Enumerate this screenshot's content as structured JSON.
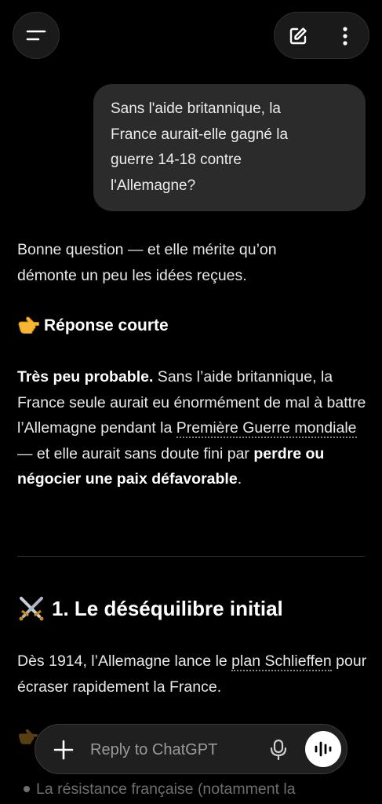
{
  "user_message": {
    "line1": "Sans l'aide britannique, la",
    "line2": "France aurait-elle gagné la",
    "line3": "guerre 14-18 contre",
    "line4": "l'Allemagne?"
  },
  "response": {
    "intro_line1": "Bonne question — et elle mérite qu’on",
    "intro_line2": "démonte un peu les idées reçues.",
    "short_heading": "Réponse courte",
    "short_p1_bold": "Très peu probable.",
    "short_p1_text": " Sans l’aide britannique, la France seule aurait eu énormément de mal à battre l’Allemagne pendant la ",
    "short_p1_link": "Première Guerre mondiale",
    "short_p1_text2": " — et elle aurait sans doute fini par ",
    "short_p1_bold2": "perdre ou négocier une paix défavorable",
    "short_p1_end": ".",
    "section1_heading": "1. Le déséquilibre initial",
    "section1_text": "Dès 1914, l’Allemagne lance le ",
    "section1_link": "plan Schlieffen",
    "section1_text2": " pour écraser rapidement la France.",
    "faded_bullet": "La résistance française (notamment la"
  },
  "composer": {
    "placeholder": "Reply to ChatGPT"
  },
  "icons": {
    "menu": "menu-icon",
    "edit": "edit-icon",
    "more": "more-vertical-icon",
    "plus": "plus-icon",
    "mic": "microphone-icon",
    "voice": "voice-mode-icon",
    "pointing": "pointing-hand-emoji",
    "swords": "crossed-swords-emoji"
  }
}
